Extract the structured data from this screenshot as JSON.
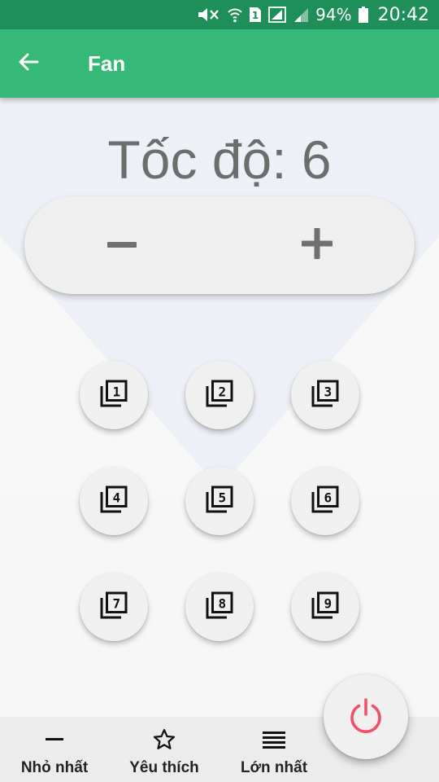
{
  "status_bar": {
    "battery": "94%",
    "time": "20:42",
    "sim_slot": "1",
    "icons": [
      "mute-icon",
      "wifi-icon",
      "sim-icon",
      "signal-icon",
      "signal-weak-icon",
      "battery-icon"
    ]
  },
  "app_bar": {
    "title": "Fan",
    "back_icon": "arrow-back-icon",
    "color": "#36b876"
  },
  "speed": {
    "label": "Tốc độ: 6",
    "minus_icon": "minus-icon",
    "plus_icon": "plus-icon"
  },
  "presets": [
    {
      "number": "1",
      "icon": "filter-1-icon"
    },
    {
      "number": "2",
      "icon": "filter-2-icon"
    },
    {
      "number": "3",
      "icon": "filter-3-icon"
    },
    {
      "number": "4",
      "icon": "filter-4-icon"
    },
    {
      "number": "5",
      "icon": "filter-5-icon"
    },
    {
      "number": "6",
      "icon": "filter-6-icon"
    },
    {
      "number": "7",
      "icon": "filter-7-icon"
    },
    {
      "number": "8",
      "icon": "filter-8-icon"
    },
    {
      "number": "9",
      "icon": "filter-9-icon"
    }
  ],
  "bottom_nav": {
    "min_label": "Nhỏ nhất",
    "fav_label": "Yêu thích",
    "max_label": "Lớn nhất",
    "min_icon": "minus-icon",
    "fav_icon": "star-outline-icon",
    "max_icon": "menu-lines-icon"
  },
  "power": {
    "icon": "power-icon",
    "color": "#f0506e"
  }
}
